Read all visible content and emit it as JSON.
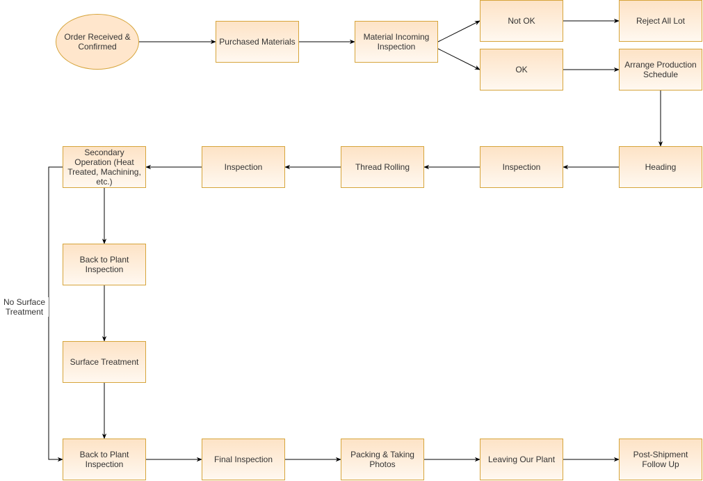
{
  "diagram": {
    "colors": {
      "node_border": "#d6a43a",
      "node_fill_top": "#fde3c6",
      "node_fill_bottom": "#fff8f0",
      "ellipse_fill": "#ffe6cc",
      "edge": "#000000",
      "text": "#333333"
    },
    "nodes": [
      {
        "id": "order",
        "label": "Order Received & Confirmed",
        "shape": "ellipse"
      },
      {
        "id": "purchased",
        "label": "Purchased Materials",
        "shape": "rect"
      },
      {
        "id": "incoming",
        "label": "Material Incoming Inspection",
        "shape": "rect"
      },
      {
        "id": "notok",
        "label": "Not OK",
        "shape": "rect"
      },
      {
        "id": "ok",
        "label": "OK",
        "shape": "rect"
      },
      {
        "id": "reject",
        "label": "Reject All Lot",
        "shape": "rect"
      },
      {
        "id": "arrange",
        "label": "Arrange Production Schedule",
        "shape": "rect"
      },
      {
        "id": "heading",
        "label": "Heading",
        "shape": "rect"
      },
      {
        "id": "inspection1",
        "label": "Inspection",
        "shape": "rect"
      },
      {
        "id": "thread",
        "label": "Thread Rolling",
        "shape": "rect"
      },
      {
        "id": "inspection2",
        "label": "Inspection",
        "shape": "rect"
      },
      {
        "id": "secondary",
        "label": "Secondary Operation (Heat Treated, Machining, etc.)",
        "shape": "rect"
      },
      {
        "id": "backplant1",
        "label": "Back to Plant Inspection",
        "shape": "rect"
      },
      {
        "id": "surface",
        "label": "Surface Treatment",
        "shape": "rect"
      },
      {
        "id": "backplant2",
        "label": "Back to Plant Inspection",
        "shape": "rect"
      },
      {
        "id": "final",
        "label": "Final Inspection",
        "shape": "rect"
      },
      {
        "id": "packing",
        "label": "Packing & Taking Photos",
        "shape": "rect"
      },
      {
        "id": "leaving",
        "label": "Leaving Our Plant",
        "shape": "rect"
      },
      {
        "id": "postship",
        "label": "Post-Shipment Follow Up",
        "shape": "rect"
      }
    ],
    "edges": [
      {
        "from": "order",
        "to": "purchased"
      },
      {
        "from": "purchased",
        "to": "incoming"
      },
      {
        "from": "incoming",
        "to": "notok"
      },
      {
        "from": "incoming",
        "to": "ok"
      },
      {
        "from": "notok",
        "to": "reject"
      },
      {
        "from": "ok",
        "to": "arrange"
      },
      {
        "from": "arrange",
        "to": "heading"
      },
      {
        "from": "heading",
        "to": "inspection1"
      },
      {
        "from": "inspection1",
        "to": "thread"
      },
      {
        "from": "thread",
        "to": "inspection2"
      },
      {
        "from": "inspection2",
        "to": "secondary"
      },
      {
        "from": "secondary",
        "to": "backplant1"
      },
      {
        "from": "backplant1",
        "to": "surface"
      },
      {
        "from": "surface",
        "to": "backplant2"
      },
      {
        "from": "secondary",
        "to": "backplant2",
        "label": "No Surface Treatment"
      },
      {
        "from": "backplant2",
        "to": "final"
      },
      {
        "from": "final",
        "to": "packing"
      },
      {
        "from": "packing",
        "to": "leaving"
      },
      {
        "from": "leaving",
        "to": "postship"
      }
    ]
  }
}
